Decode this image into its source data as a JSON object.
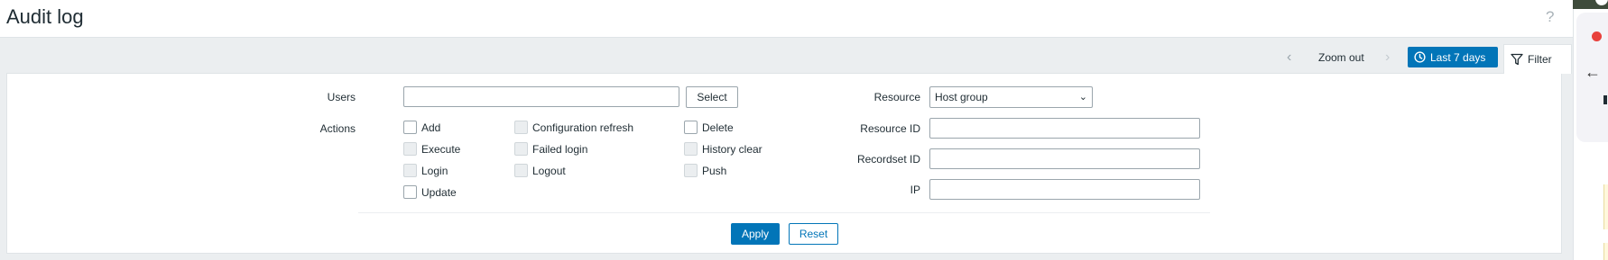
{
  "page": {
    "title": "Audit log",
    "help_icon": "?"
  },
  "nav": {
    "prev_icon": "‹",
    "zoom_out": "Zoom out",
    "next_icon": "›",
    "time_range": "Last 7 days",
    "filter_tab": "Filter"
  },
  "filter": {
    "users_label": "Users",
    "users_value": "",
    "select_button": "Select",
    "actions_label": "Actions",
    "actions": [
      {
        "label": "Add",
        "enabled": true
      },
      {
        "label": "Configuration refresh",
        "enabled": false
      },
      {
        "label": "Delete",
        "enabled": true
      },
      {
        "label": "Execute",
        "enabled": false
      },
      {
        "label": "Failed login",
        "enabled": false
      },
      {
        "label": "History clear",
        "enabled": false
      },
      {
        "label": "Login",
        "enabled": false
      },
      {
        "label": "Logout",
        "enabled": false
      },
      {
        "label": "Push",
        "enabled": false
      },
      {
        "label": "Update",
        "enabled": true
      }
    ],
    "resource_label": "Resource",
    "resource_value": "Host group",
    "resource_id_label": "Resource ID",
    "resource_id_value": "",
    "recordset_id_label": "Recordset ID",
    "recordset_id_value": "",
    "ip_label": "IP",
    "ip_value": "",
    "apply": "Apply",
    "reset": "Reset"
  },
  "colors": {
    "accent": "#0275b8",
    "background": "#ebeef0"
  }
}
